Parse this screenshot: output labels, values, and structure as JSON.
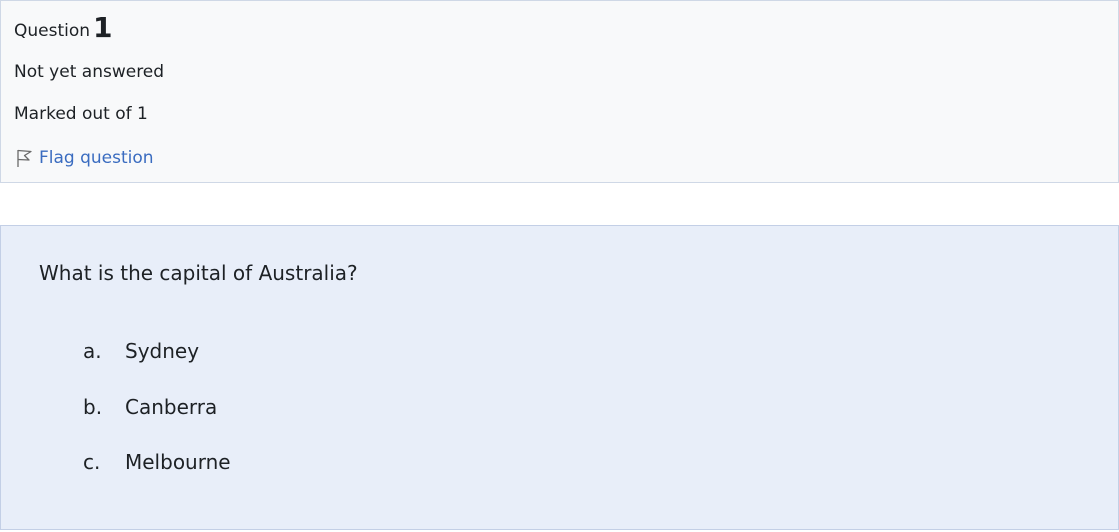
{
  "info": {
    "question_word": "Question",
    "question_number": "1",
    "state": "Not yet answered",
    "grade": "Marked out of 1",
    "flag_label": "Flag question"
  },
  "question": {
    "text": "What is the capital of Australia?",
    "answers": [
      {
        "letter": "a.",
        "label": "Sydney"
      },
      {
        "letter": "b.",
        "label": "Canberra"
      },
      {
        "letter": "c.",
        "label": "Melbourne"
      }
    ]
  },
  "colors": {
    "info_background": "#f8f9fa",
    "content_background": "#e8eef9",
    "link": "#3a6cc0"
  },
  "icons": {
    "flag": "flag-icon"
  }
}
